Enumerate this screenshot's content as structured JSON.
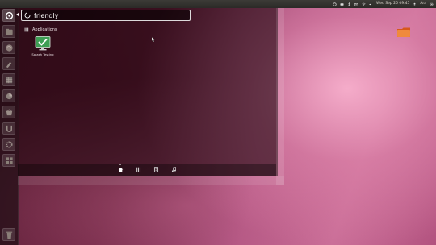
{
  "top_panel": {
    "clock": "Wed Sep 26 09:45",
    "user": "Ara",
    "icons": [
      "indicator-icon",
      "keyboard-icon",
      "bluetooth-icon",
      "mail-icon",
      "network-icon",
      "volume-icon",
      "power-gear-icon"
    ]
  },
  "launcher": {
    "items": [
      "bfb-dash-icon",
      "files-icon",
      "firefox-icon",
      "libreoffice-writer-icon",
      "libreoffice-calc-icon",
      "libreoffice-impress-icon",
      "software-center-icon",
      "ubuntu-one-icon",
      "settings-icon",
      "workspaces-icon",
      "trash-icon"
    ]
  },
  "dash": {
    "search_value": "friendly",
    "section_title": "Applications",
    "results": [
      {
        "label": "Splash Testing",
        "icon": "monitor-check-icon"
      }
    ],
    "lenses": [
      "home-lens-icon",
      "applications-lens-icon",
      "files-lens-icon",
      "music-lens-icon"
    ],
    "active_lens": "home-lens-icon"
  },
  "desktop": {
    "icons": [
      "folder-icon"
    ]
  },
  "colors": {
    "panel": "#3c3b37",
    "accent": "#dd4814",
    "wallpaper_light": "#f2a9c8",
    "wallpaper_dark": "#3a0c1c"
  }
}
